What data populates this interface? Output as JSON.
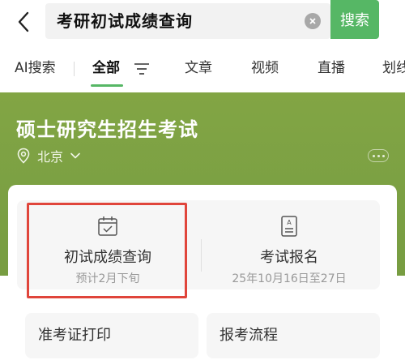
{
  "search": {
    "query": "考研初试成绩查询",
    "button_label": "搜索"
  },
  "tabs": [
    {
      "label": "AI搜索"
    },
    {
      "label": "全部"
    },
    {
      "label": "文章"
    },
    {
      "label": "视频"
    },
    {
      "label": "直播"
    },
    {
      "label": "划线"
    }
  ],
  "card": {
    "title": "硕士研究生招生考试",
    "location": "北京"
  },
  "services": [
    {
      "name": "初试成绩查询",
      "sub": "预计2月下旬",
      "icon": "calendar-check-icon"
    },
    {
      "name": "考试报名",
      "sub": "25年10月16日至27日",
      "icon": "document-a-icon"
    }
  ],
  "links": [
    {
      "label": "准考证打印"
    },
    {
      "label": "报考流程"
    }
  ],
  "colors": {
    "accent": "#56b765",
    "card_green": "#7ba043",
    "highlight_red": "#e0453b"
  }
}
